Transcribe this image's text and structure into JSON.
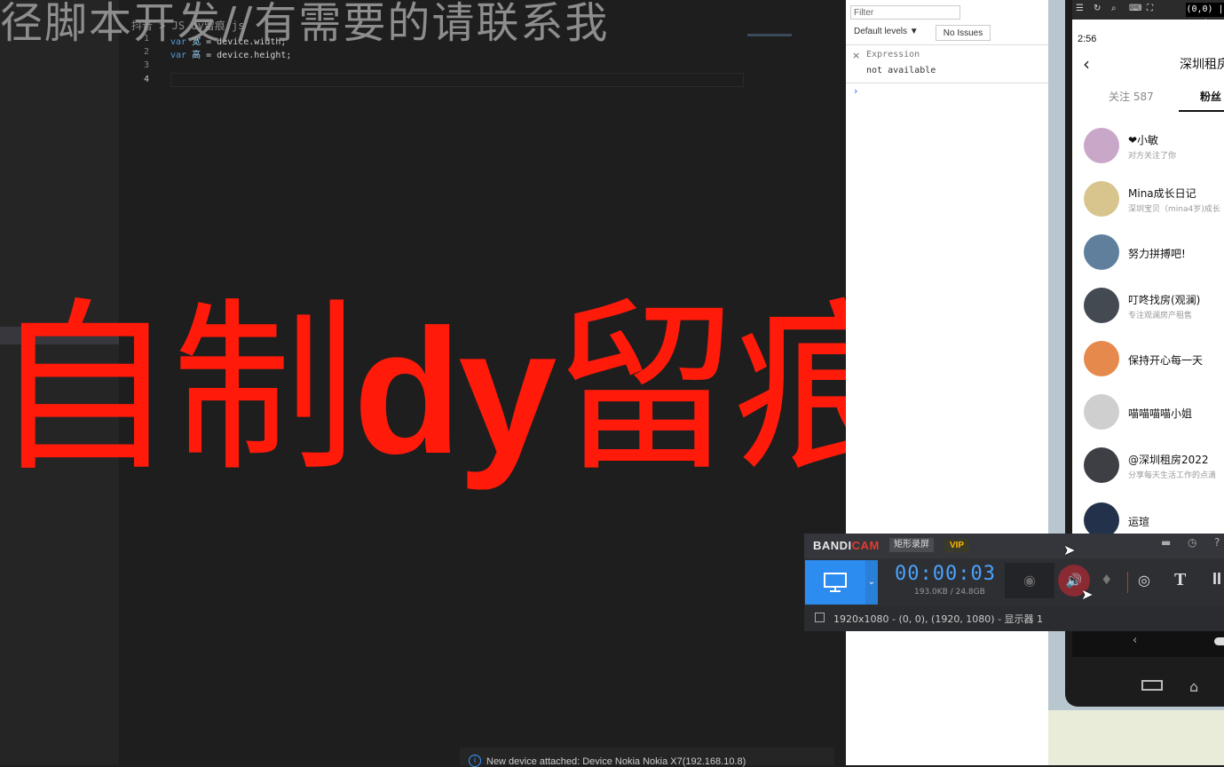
{
  "overlay": {
    "top_banner": "径脚本开发//有需要的请联系我",
    "title_pre": "自制",
    "title_mid": "dy",
    "title_post": "留痕脚本"
  },
  "editor": {
    "breadcrumb": "抖音 > JS dy留痕.js",
    "lines": [
      {
        "num": "1",
        "kw": "var",
        "id": "宽",
        "rest": " = device.width;"
      },
      {
        "num": "2",
        "kw": "var",
        "id": "高",
        "rest": " = device.height;"
      },
      {
        "num": "3",
        "kw": "",
        "id": "",
        "rest": ""
      },
      {
        "num": "4",
        "kw": "",
        "id": "",
        "rest": ""
      }
    ],
    "notification": "New device attached: Device Nokia Nokia X7(192.168.10.8)"
  },
  "console": {
    "filter_placeholder": "Filter",
    "levels_label": "Default levels ▼",
    "issues_label": "No Issues",
    "expression_label": "Expression",
    "expression_value": "not available",
    "prompt": "›"
  },
  "emulator": {
    "coords": "(0,0) | (",
    "status_time": "2:56",
    "page_title": "深圳租房",
    "tab_follow": "关注 587",
    "tab_fans": "粉丝",
    "fans": [
      {
        "name": "❤小敏",
        "sub": "对方关注了你",
        "color": "#c9a7c9"
      },
      {
        "name": "Mina成长日记",
        "sub": "深圳宝贝（mina4岁)成长",
        "color": "#d8c58e"
      },
      {
        "name": "努力拼搏吧!",
        "sub": "",
        "color": "#5f7f9c"
      },
      {
        "name": "叮咚找房(观澜)",
        "sub": "专注观澜房产租售",
        "color": "#444a52"
      },
      {
        "name": "保持开心每一天",
        "sub": "",
        "color": "#e58a4c"
      },
      {
        "name": "喵喵喵喵小姐",
        "sub": "",
        "color": "#cfcfcf"
      },
      {
        "name": "@深圳租房2022",
        "sub": "分享每天生活工作的点滴",
        "color": "#3d3f45"
      },
      {
        "name": "运瑄",
        "sub": "",
        "color": "#23324a"
      }
    ]
  },
  "bandicam": {
    "brand_a": "BANDI",
    "brand_b": "CAM",
    "mode": "矩形录屏",
    "vip": "VIP",
    "timer": "00:00:03",
    "size": "193.0KB / 24.8GB",
    "text_tool": "T",
    "pause": "II",
    "area_info": "1920x1080 - (0, 0), (1920, 1080) - 显示器 1"
  }
}
